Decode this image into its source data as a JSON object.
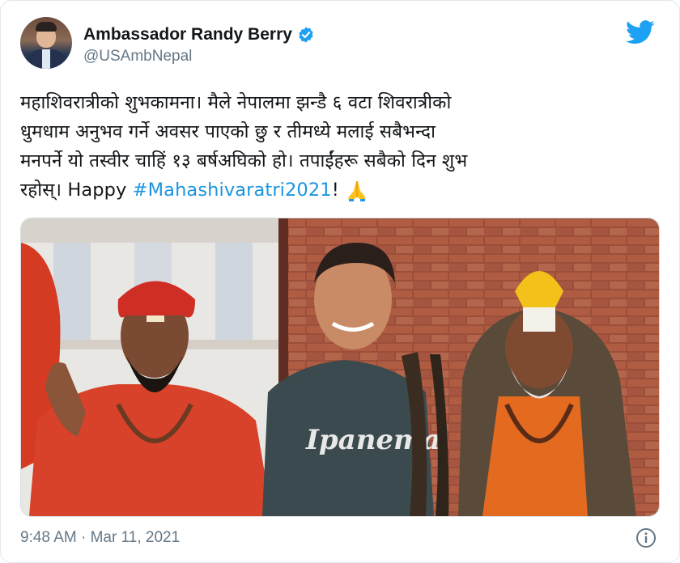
{
  "author": {
    "display_name": "Ambassador Randy Berry",
    "handle": "@USAmbNepal",
    "verified_icon": "verified-badge-icon",
    "avatar_icon": "profile-avatar"
  },
  "tweet": {
    "lines": [
      "महाशिवरात्रीको शुभकामना। मैले नेपालमा झन्डै ६ वटा शिवरात्रीको",
      "धुमधाम अनुभव गर्ने अवसर पाएको छु र तीमध्ये मलाई सबैभन्दा",
      "मनपर्ने यो तस्वीर चाहिं १३ बर्षअघिको हो। तपाईंहरू सबैको दिन शुभ"
    ],
    "last_line_prefix": "रहोस्। Happy ",
    "hashtag": "#Mahashivaratri2021",
    "last_line_suffix": "!",
    "emoji_icon": "folded-hands-icon"
  },
  "photo": {
    "shirt_text": "Ipanema"
  },
  "footer": {
    "timestamp": "9:48 AM · Mar 11, 2021",
    "info_icon": "info-icon"
  },
  "colors": {
    "link": "#1b95e0",
    "twitter_blue": "#1da1f2",
    "secondary_text": "#657786"
  }
}
